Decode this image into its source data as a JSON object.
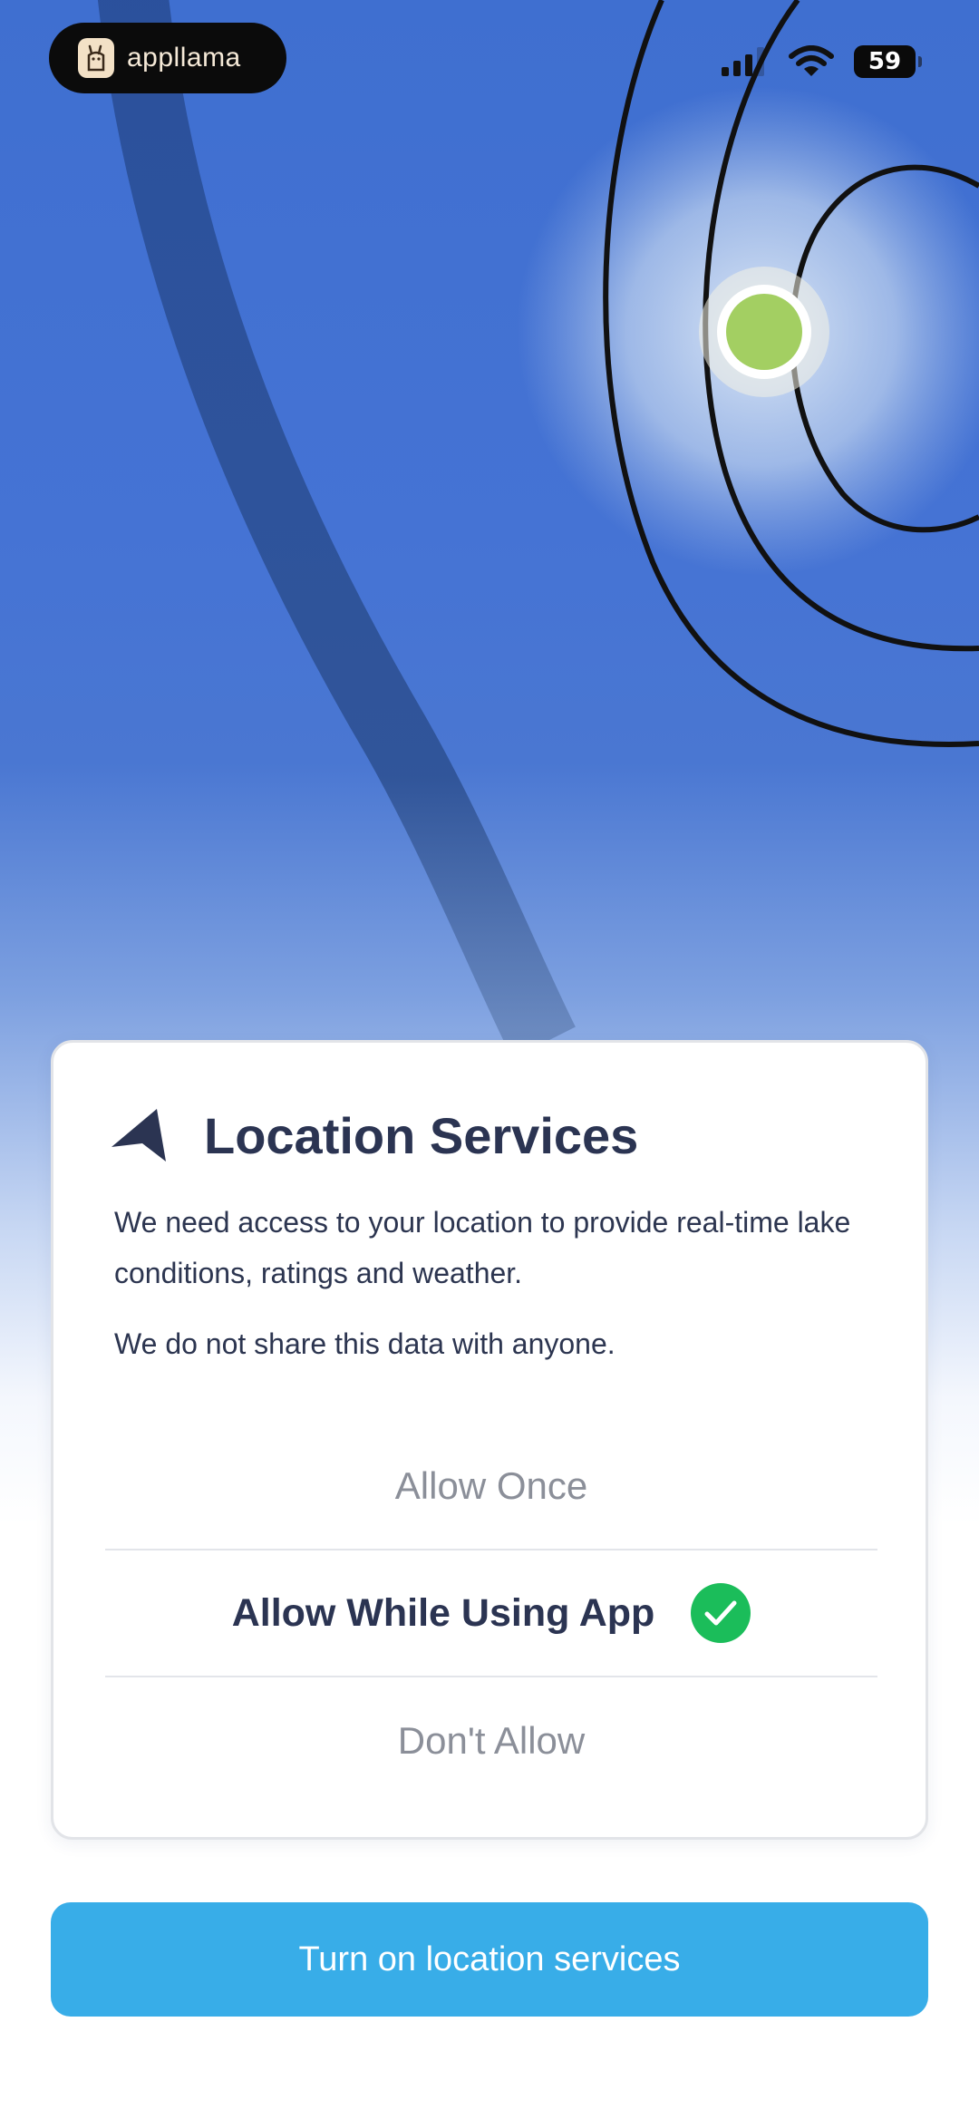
{
  "status_bar": {
    "brand_name": "appllama",
    "brand_icon": "llama-icon",
    "battery_level": "59",
    "icons": [
      "signal-icon",
      "wifi-icon",
      "battery-icon"
    ]
  },
  "card": {
    "icon": "location-arrow-icon",
    "title": "Location Services",
    "body_1": "We need access to your location to provide real-time lake conditions, ratings and weather.",
    "body_2": "We do not share this data with anyone.",
    "options": [
      {
        "label": "Allow Once",
        "selected": false
      },
      {
        "label": "Allow While Using App",
        "selected": true
      },
      {
        "label": "Don't Allow",
        "selected": false
      }
    ]
  },
  "cta": {
    "label": "Turn on location services"
  },
  "colors": {
    "primary": "#38ade8",
    "title": "#2b3452",
    "muted": "#8b8f99",
    "success": "#1bbd5a",
    "marker": "#a3cf62",
    "background_top": "#3f6fd0"
  }
}
